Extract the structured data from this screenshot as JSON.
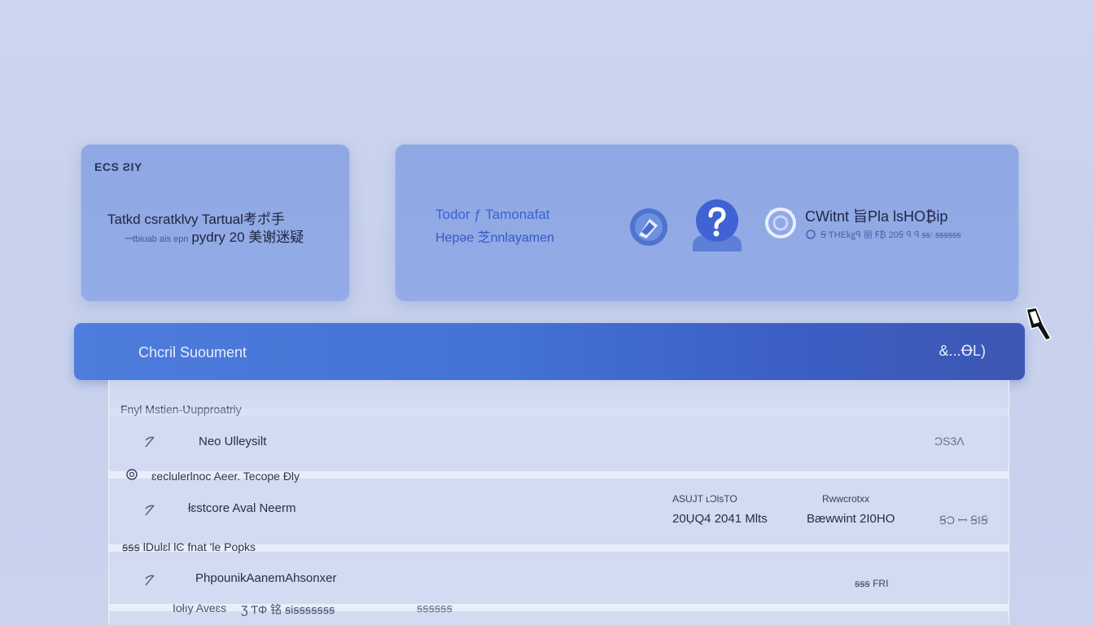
{
  "left_card": {
    "title": "ECS ƧIY",
    "line1": "Tatkd csratklvy Tartual考ポ手",
    "line2_small": "ꟷtbiuab ais epn",
    "line2_big": "pydry 20 美谢迷疑"
  },
  "right_card": {
    "line1": "Todor ƒ Tamonafat",
    "line2": "Hepəe 芝nnlayamen",
    "title": "CWitnt 旨Pla ƖsHO₿ip",
    "subtitle": "Ꞩ  ƬHE㎏ꟼ 丽 Ꞙ₿ 20Ꞩ  ꟼ ꟼ ꞩꞩ꞉ ꞩꞩꞩꞩꞩꞩ"
  },
  "banner": {
    "title": "Chcril Suoument",
    "action": "&...ꝊL)"
  },
  "list": {
    "section1": "Fnyl Mstien-Ʋupproatriy",
    "row1": {
      "label": "Neo Ulleysilt",
      "value": "ƆS3Λ"
    },
    "section2": "ɛeclulerlnoc Aeer. Tecope Ɖly",
    "row2": {
      "label": "łɛstcore  Aval Neerm",
      "meta1_label": "ASUJT ʟƆlsTO",
      "meta1_value": "20ỤQ4  2041 Mlts",
      "meta2_label": "Rwwcrotxx",
      "meta2_value": "Bæwwint 2I0HO",
      "meta3_value": "ꞨƆ ꟷ ꞨIꞨ"
    },
    "section3": "ꞩꞩꞩ ƖDulɛl  lϾ fnat ʹle Popks",
    "row3": {
      "label": "PhpounikAanemAhsonxer",
      "value": "ꞩꞩꞩ FRI"
    },
    "row4": {
      "text_a": "Iołıy Aveɛs",
      "text_b": "Ʒ  ƬΦ 铭 ꞩiꞩꞩꞩꞩꞩꞩꞩ",
      "text_c": "ꞩꞩꞩꞩꞩꞩ"
    }
  },
  "colors": {
    "card_bg": "#8fa8e3",
    "banner_start": "#4e7ddc",
    "banner_end": "#3d57b3",
    "accent_blue": "#3a62d6",
    "page_bg": "#cdd6ee"
  },
  "icons": [
    "round-map-icon",
    "help-question-icon",
    "swirl-icon",
    "chat-icon",
    "search-icon",
    "cursor-icon"
  ]
}
